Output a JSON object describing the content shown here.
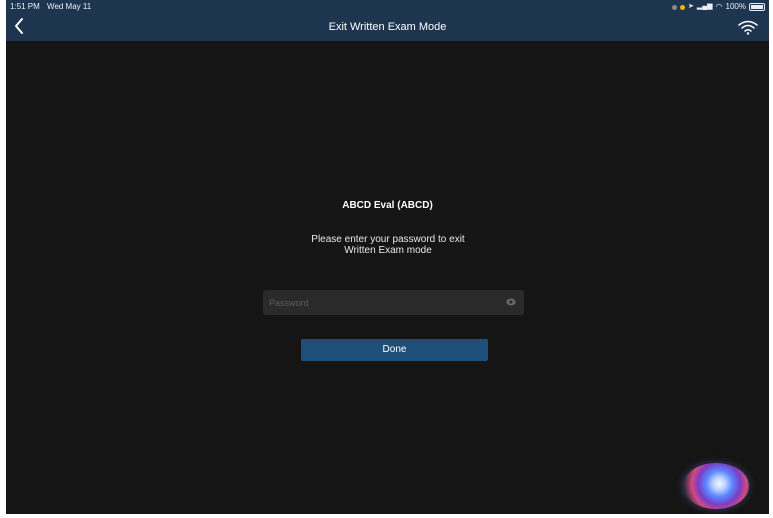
{
  "status_bar": {
    "time": "1:51 PM",
    "date": "Wed May 11",
    "battery": "100%"
  },
  "nav": {
    "back_label": "<",
    "title": "Exit Written Exam Mode"
  },
  "exam": {
    "title": "ABCD Eval (ABCD)",
    "instruction_line1": "Please enter your password to exit",
    "instruction_line2": "Written Exam mode"
  },
  "password": {
    "placeholder": "Password",
    "value": ""
  },
  "done_label": "Done",
  "colors": {
    "nav_background": "#1e3550",
    "screen_background": "#151515",
    "field_background": "#2a2a2a",
    "button_background": "#1e4f7a",
    "text": "#ffffff"
  },
  "icons": {
    "back": "chevron-left-icon",
    "wifi": "wifi-icon",
    "eye": "eye-icon",
    "siri": "siri-icon"
  }
}
